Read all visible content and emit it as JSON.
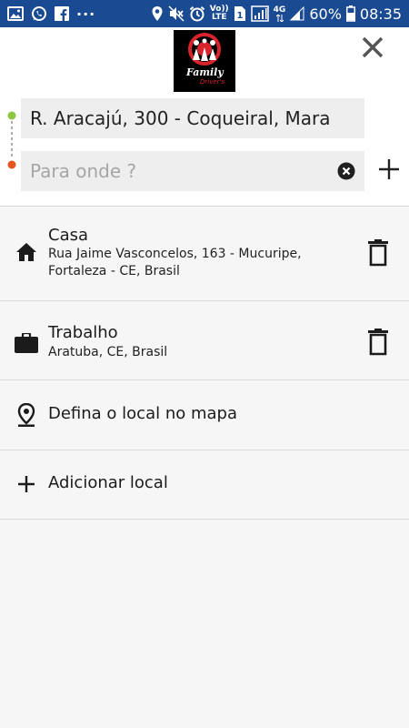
{
  "status_bar": {
    "battery": "60%",
    "time": "08:35",
    "network": "4G",
    "volte_top": "Vo))",
    "volte_bottom": "LTE",
    "sim": "1",
    "more": "···",
    "left_icons": [
      "image-icon",
      "whatsapp-icon",
      "facebook-icon"
    ],
    "right_icons": [
      "location-icon",
      "mute-icon",
      "alarm-icon",
      "signal-icon",
      "battery-icon"
    ]
  },
  "header": {
    "logo_text_top": "Family",
    "logo_text_bottom": "Driver's",
    "logo_colors": {
      "background": "#000000",
      "accent": "#d9232d"
    },
    "close_icon": "close-icon"
  },
  "search": {
    "origin_value": "R. Aracajú, 300 - Coqueiral, Mara",
    "destination_placeholder": "Para onde ?",
    "origin_dot_color": "#8dc63f",
    "destination_dot_color": "#e4551f"
  },
  "places": [
    {
      "icon": "home-icon",
      "title": "Casa",
      "subtitle": "Rua Jaime Vasconcelos, 163 - Mucuripe, Fortaleza - CE, Brasil"
    },
    {
      "icon": "briefcase-icon",
      "title": "Trabalho",
      "subtitle": "Aratuba, CE, Brasil"
    }
  ],
  "actions": {
    "set_on_map": "Defina o local no mapa",
    "add_place": "Adicionar local"
  },
  "colors": {
    "status_bar": "#1a4a92",
    "background": "#f6f6f6"
  }
}
